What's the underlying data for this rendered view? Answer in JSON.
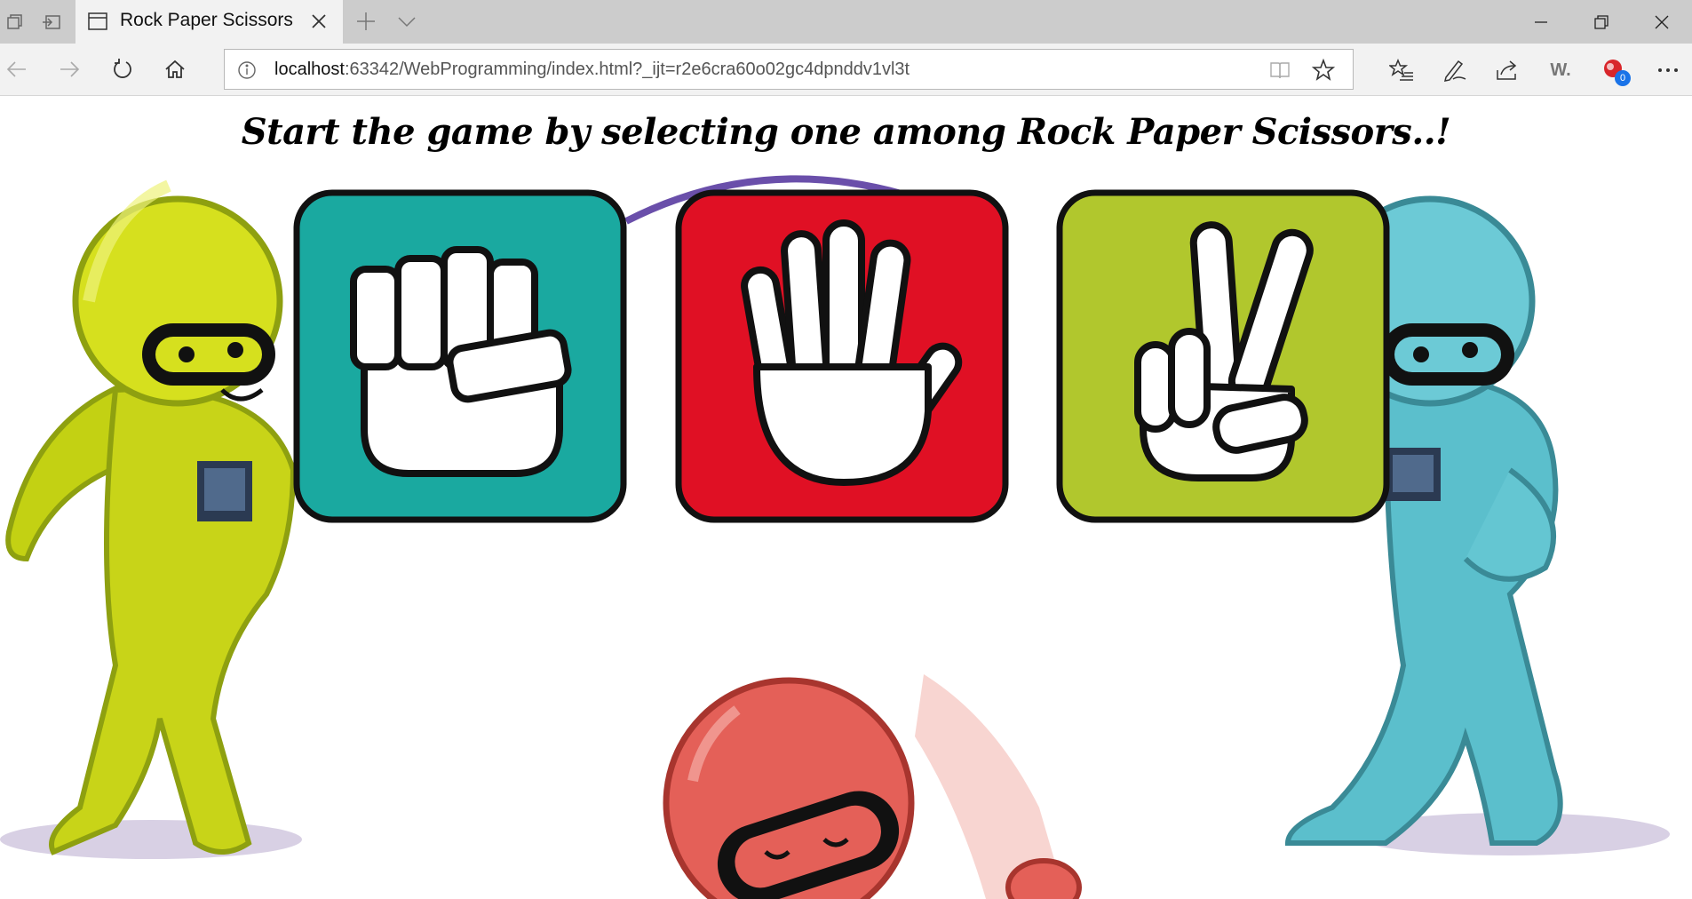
{
  "browser": {
    "tab_title": "Rock Paper Scissors",
    "url_host": "localhost",
    "url_rest": ":63342/WebProgramming/index.html?_ijt=r2e6cra60o02gc4dpnddv1vl3t",
    "extension_badge_count": "0",
    "extension_w_label": "W."
  },
  "page": {
    "heading": "Start the game by selecting one among Rock Paper Scissors..!"
  },
  "choices": [
    {
      "name": "rock",
      "color": "#1aa9a0"
    },
    {
      "name": "paper",
      "color": "#e01024"
    },
    {
      "name": "scissors",
      "color": "#b1c72d"
    }
  ],
  "colors": {
    "yellow_character": "#c8d418",
    "blue_character": "#5bbfcc",
    "red_character": "#e46058",
    "arrow": "#6a4faa"
  }
}
